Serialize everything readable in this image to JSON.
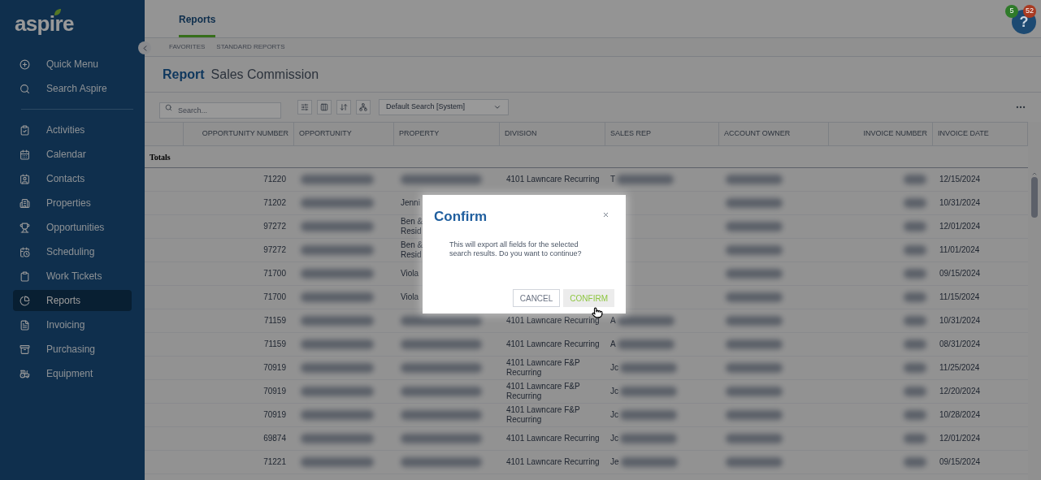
{
  "sidebar": {
    "logo": "aspire",
    "items": [
      {
        "label": "Quick Menu",
        "selected": false
      },
      {
        "label": "Search Aspire",
        "selected": false
      },
      {
        "label": "Activities",
        "selected": false
      },
      {
        "label": "Calendar",
        "selected": false
      },
      {
        "label": "Contacts",
        "selected": false
      },
      {
        "label": "Properties",
        "selected": false
      },
      {
        "label": "Opportunities",
        "selected": false
      },
      {
        "label": "Scheduling",
        "selected": false
      },
      {
        "label": "Work Tickets",
        "selected": false
      },
      {
        "label": "Reports",
        "selected": true
      },
      {
        "label": "Invoicing",
        "selected": false
      },
      {
        "label": "Purchasing",
        "selected": false
      },
      {
        "label": "Equipment",
        "selected": false
      }
    ]
  },
  "header": {
    "tabs": [
      {
        "label": "Reports",
        "selected": true
      }
    ],
    "help": "?",
    "badges": [
      {
        "count": "5",
        "color": "#2f7a2a"
      },
      {
        "count": "52",
        "color": "#a83a22"
      }
    ]
  },
  "subtabs": [
    {
      "label": "FAVORITES",
      "selected": false
    },
    {
      "label": "STANDARD REPORTS",
      "selected": false
    }
  ],
  "title": {
    "prefix": "Report",
    "name": "Sales Commission"
  },
  "toolbar": {
    "search_placeholder": "Search...",
    "saved_search": "Default Search [System]"
  },
  "table": {
    "columns": [
      "OPPORTUNITY NUMBER",
      "OPPORTUNITY",
      "PROPERTY",
      "DIVISION",
      "SALES REP",
      "ACCOUNT OWNER",
      "INVOICE NUMBER",
      "INVOICE DATE"
    ],
    "totals_label": "Totals",
    "rows": [
      {
        "opportunity_number": "71220",
        "division": "4101 Lawncare Recurring",
        "sales_rep": "T",
        "invoice_date": "12/15/2024"
      },
      {
        "opportunity_number": "71202",
        "property": "Jenni",
        "invoice_date": "10/31/2024"
      },
      {
        "opportunity_number": "97272",
        "property": "Ben &\nResid",
        "invoice_date": "12/01/2024"
      },
      {
        "opportunity_number": "97272",
        "property": "Ben &\nResid",
        "invoice_date": "11/01/2024"
      },
      {
        "opportunity_number": "71700",
        "property": "Viola",
        "invoice_date": "09/15/2024"
      },
      {
        "opportunity_number": "71700",
        "property": "Viola",
        "invoice_date": "11/15/2024"
      },
      {
        "opportunity_number": "71159",
        "division": "4101 Lawncare Recurring",
        "sales_rep": "A",
        "invoice_date": "10/31/2024"
      },
      {
        "opportunity_number": "71159",
        "division": "4101 Lawncare Recurring",
        "sales_rep": "A",
        "invoice_date": "08/31/2024"
      },
      {
        "opportunity_number": "70919",
        "division": "4101 Lawncare F&P\nRecurring",
        "sales_rep": "Jc",
        "invoice_date": "11/25/2024"
      },
      {
        "opportunity_number": "70919",
        "division": "4101 Lawncare F&P\nRecurring",
        "sales_rep": "Jc",
        "invoice_date": "12/20/2024"
      },
      {
        "opportunity_number": "70919",
        "division": "4101 Lawncare F&P\nRecurring",
        "sales_rep": "Jc",
        "invoice_date": "10/28/2024"
      },
      {
        "opportunity_number": "69874",
        "division": "4101 Lawncare Recurring",
        "sales_rep": "Jc",
        "invoice_date": "12/01/2024"
      },
      {
        "opportunity_number": "71221",
        "division": "4101 Lawncare Recurring",
        "sales_rep": "Je",
        "invoice_date": "09/15/2024"
      }
    ]
  },
  "dialog": {
    "title": "Confirm",
    "message": "This will export all fields for the selected search results. Do you want to continue?",
    "buttons": [
      {
        "label": "CANCEL",
        "kind": "secondary",
        "hovered": false
      },
      {
        "label": "CONFIRM",
        "kind": "primary",
        "hovered": true
      }
    ]
  }
}
